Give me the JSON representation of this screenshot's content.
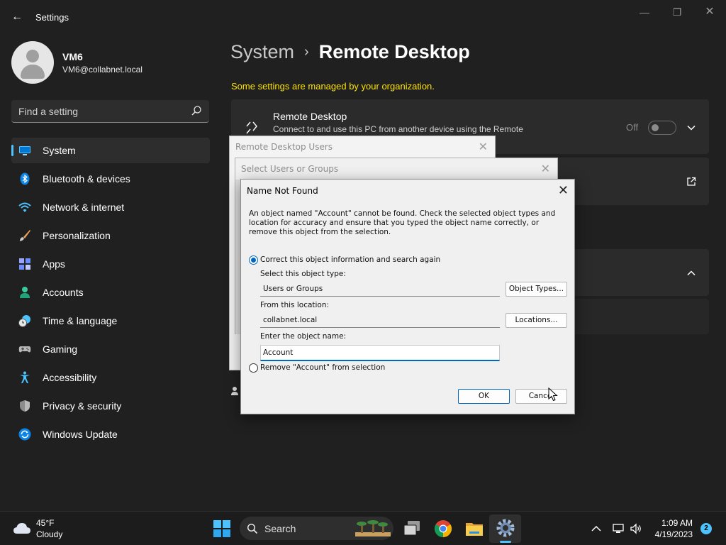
{
  "window": {
    "title": "Settings",
    "back_glyph": "←",
    "minimize_glyph": "—",
    "maximize_glyph": "❐",
    "close_glyph": "✕"
  },
  "user": {
    "name": "VM6",
    "email": "VM6@collabnet.local"
  },
  "search": {
    "placeholder": "Find a setting"
  },
  "sidebar": {
    "items": [
      {
        "label": "System",
        "icon": "system-icon",
        "active": true
      },
      {
        "label": "Bluetooth & devices",
        "icon": "bluetooth-icon"
      },
      {
        "label": "Network & internet",
        "icon": "wifi-icon"
      },
      {
        "label": "Personalization",
        "icon": "brush-icon"
      },
      {
        "label": "Apps",
        "icon": "apps-icon"
      },
      {
        "label": "Accounts",
        "icon": "person-icon"
      },
      {
        "label": "Time & language",
        "icon": "clock-globe-icon"
      },
      {
        "label": "Gaming",
        "icon": "gamepad-icon"
      },
      {
        "label": "Accessibility",
        "icon": "accessibility-icon"
      },
      {
        "label": "Privacy & security",
        "icon": "shield-icon"
      },
      {
        "label": "Windows Update",
        "icon": "update-icon"
      }
    ]
  },
  "main": {
    "breadcrumb_parent": "System",
    "breadcrumb_separator": "›",
    "breadcrumb_current": "Remote Desktop",
    "managed_notice": "Some settings are managed by your organization.",
    "remote_desktop_card": {
      "title": "Remote Desktop",
      "description": "Connect to and use this PC from another device using the Remote",
      "toggle_label": "Off",
      "toggle_on": false
    }
  },
  "dialogs": {
    "remote_desktop_users": {
      "title": "Remote Desktop Users",
      "close_glyph": "✕"
    },
    "select_users": {
      "title": "Select Users or Groups",
      "close_glyph": "✕"
    },
    "name_not_found": {
      "title": "Name Not Found",
      "close_glyph": "✕",
      "message": "An object named \"Account\" cannot be found. Check the selected object types and location for accuracy and ensure that you typed the object name correctly, or remove this object from the selection.",
      "option_correct": "Correct this object information and search again",
      "object_type_label": "Select this object type:",
      "object_type_value": "Users or Groups",
      "object_types_button": "Object Types...",
      "location_label": "From this location:",
      "location_value": "collabnet.local",
      "locations_button": "Locations...",
      "object_name_label": "Enter the object name:",
      "object_name_value": "Account",
      "option_remove": "Remove \"Account\" from selection",
      "ok_button": "OK",
      "cancel_button": "Cancel"
    }
  },
  "taskbar": {
    "weather_temp": "45°F",
    "weather_condition": "Cloudy",
    "search_label": "Search",
    "time": "1:09 AM",
    "date": "4/19/2023",
    "notification_count": "2",
    "apps": [
      "start-icon",
      "search-icon",
      "task-view-icon",
      "chrome-icon",
      "file-explorer-icon",
      "settings-icon"
    ]
  },
  "colors": {
    "accent": "#4cc2ff",
    "managed_notice": "#fce100",
    "dialog_accent": "#0067c0"
  }
}
